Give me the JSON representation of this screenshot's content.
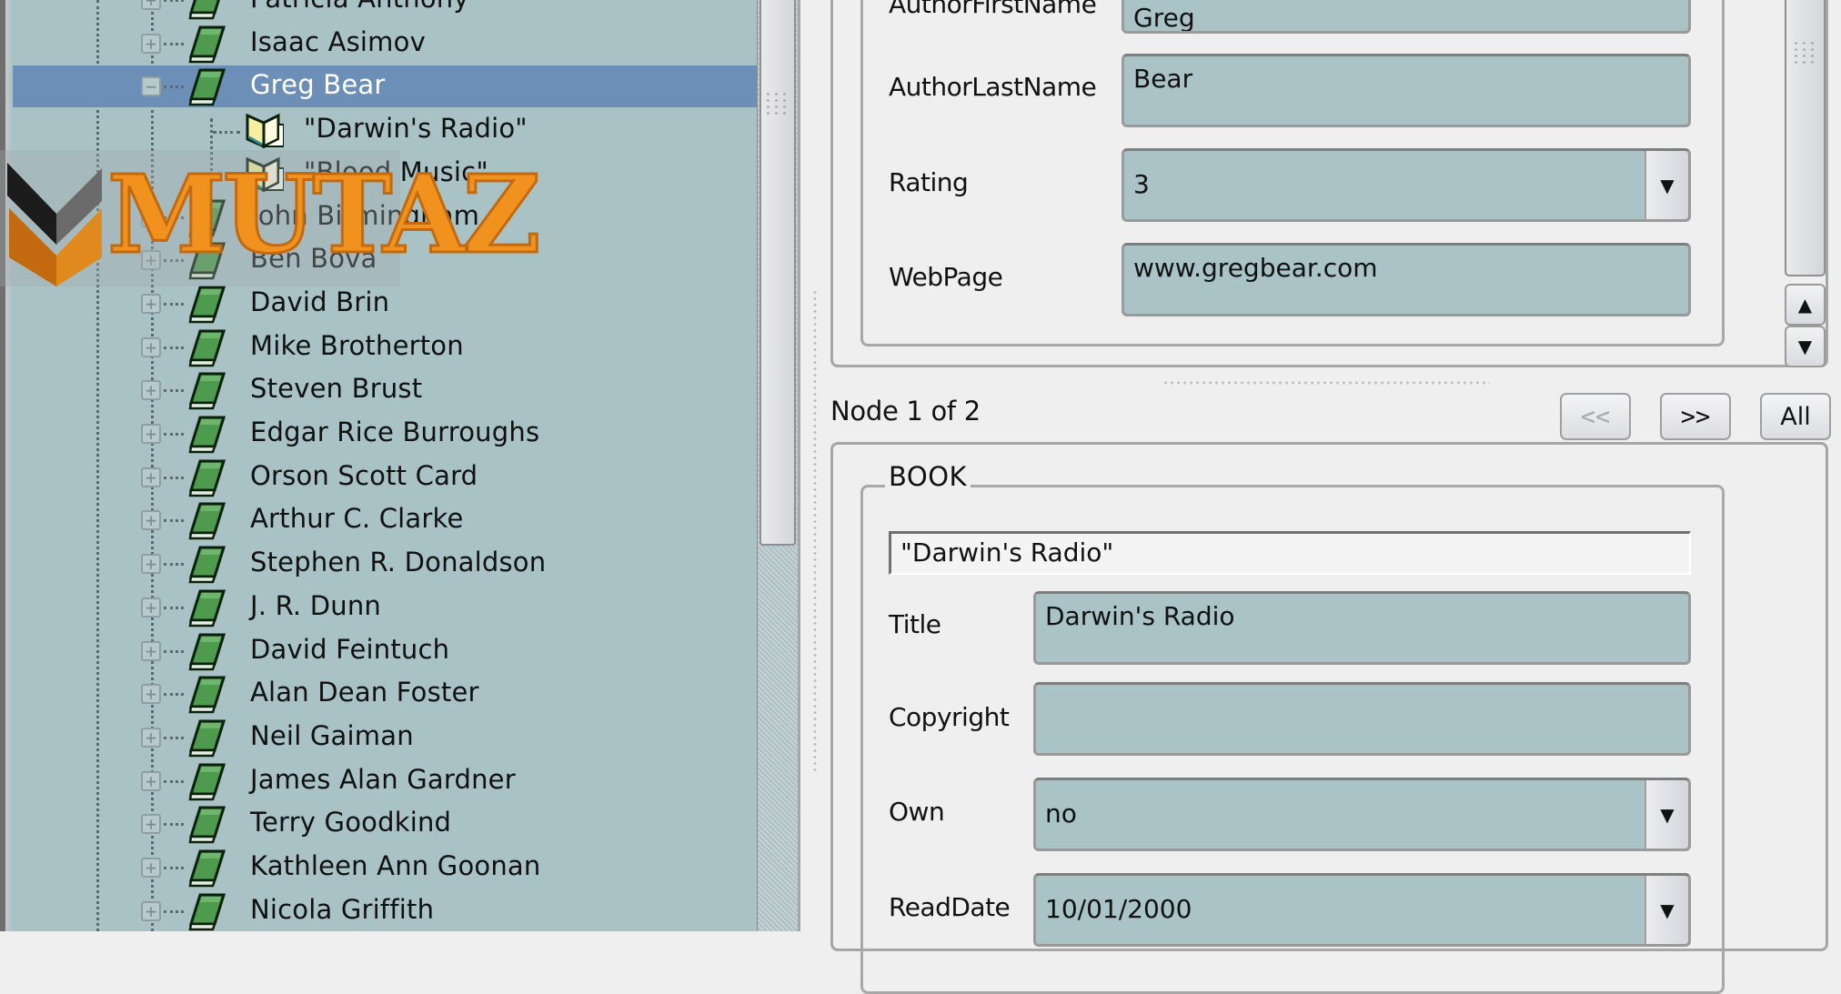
{
  "tree": {
    "items": [
      {
        "label": "Patricia Anthony",
        "level": 0,
        "expander": "+",
        "icon": "closed-book-icon",
        "selected": false
      },
      {
        "label": "Isaac Asimov",
        "level": 0,
        "expander": "+",
        "icon": "closed-book-icon",
        "selected": false
      },
      {
        "label": "Greg Bear",
        "level": 0,
        "expander": "−",
        "icon": "closed-book-icon",
        "selected": true
      },
      {
        "label": "\"Darwin's Radio\"",
        "level": 1,
        "expander": "",
        "icon": "open-book-icon",
        "selected": false
      },
      {
        "label": "\"Blood Music\"",
        "level": 1,
        "expander": "",
        "icon": "open-book-icon",
        "selected": false
      },
      {
        "label": "John Birmingham",
        "level": 0,
        "expander": "+",
        "icon": "closed-book-icon",
        "selected": false
      },
      {
        "label": "Ben Bova",
        "level": 0,
        "expander": "+",
        "icon": "closed-book-icon",
        "selected": false
      },
      {
        "label": "David Brin",
        "level": 0,
        "expander": "+",
        "icon": "closed-book-icon",
        "selected": false
      },
      {
        "label": "Mike Brotherton",
        "level": 0,
        "expander": "+",
        "icon": "closed-book-icon",
        "selected": false
      },
      {
        "label": "Steven Brust",
        "level": 0,
        "expander": "+",
        "icon": "closed-book-icon",
        "selected": false
      },
      {
        "label": "Edgar Rice Burroughs",
        "level": 0,
        "expander": "+",
        "icon": "closed-book-icon",
        "selected": false
      },
      {
        "label": "Orson Scott Card",
        "level": 0,
        "expander": "+",
        "icon": "closed-book-icon",
        "selected": false
      },
      {
        "label": "Arthur C. Clarke",
        "level": 0,
        "expander": "+",
        "icon": "closed-book-icon",
        "selected": false
      },
      {
        "label": "Stephen R. Donaldson",
        "level": 0,
        "expander": "+",
        "icon": "closed-book-icon",
        "selected": false
      },
      {
        "label": "J. R. Dunn",
        "level": 0,
        "expander": "+",
        "icon": "closed-book-icon",
        "selected": false
      },
      {
        "label": "David Feintuch",
        "level": 0,
        "expander": "+",
        "icon": "closed-book-icon",
        "selected": false
      },
      {
        "label": "Alan Dean Foster",
        "level": 0,
        "expander": "+",
        "icon": "closed-book-icon",
        "selected": false
      },
      {
        "label": "Neil Gaiman",
        "level": 0,
        "expander": "+",
        "icon": "closed-book-icon",
        "selected": false
      },
      {
        "label": "James Alan Gardner",
        "level": 0,
        "expander": "+",
        "icon": "closed-book-icon",
        "selected": false
      },
      {
        "label": "Terry Goodkind",
        "level": 0,
        "expander": "+",
        "icon": "closed-book-icon",
        "selected": false
      },
      {
        "label": "Kathleen Ann Goonan",
        "level": 0,
        "expander": "+",
        "icon": "closed-book-icon",
        "selected": false
      },
      {
        "label": "Nicola Griffith",
        "level": 0,
        "expander": "+",
        "icon": "closed-book-icon",
        "selected": false
      }
    ]
  },
  "author_form": {
    "fields": [
      {
        "label": "AuthorFirstName",
        "value": "Greg",
        "type": "text"
      },
      {
        "label": "AuthorLastName",
        "value": "Bear",
        "type": "text"
      },
      {
        "label": "Rating",
        "value": "3",
        "type": "combo"
      },
      {
        "label": "WebPage",
        "value": "www.gregbear.com",
        "type": "text"
      }
    ]
  },
  "navigation": {
    "node_label": "Node 1 of 2",
    "prev_label": "<<",
    "next_label": ">>",
    "all_label": "All",
    "prev_enabled": false
  },
  "book_form": {
    "group_title": "BOOK",
    "heading": "\"Darwin's Radio\"",
    "fields": [
      {
        "label": "Title",
        "value": "Darwin's Radio",
        "type": "text"
      },
      {
        "label": "Copyright",
        "value": "",
        "type": "text"
      },
      {
        "label": "Own",
        "value": "no",
        "type": "combo"
      },
      {
        "label": "ReadDate",
        "value": "10/01/2000",
        "type": "combo"
      }
    ]
  },
  "icons": {
    "scroll_up": "▲",
    "scroll_down": "▼",
    "combo_arrow": "▼"
  },
  "watermark": {
    "text": "MUTAZ"
  },
  "colors": {
    "tree_background": "#a9c2c6",
    "selection": "#6b8fb6",
    "input_background": "#a9c3c7",
    "window_background": "#efefef",
    "watermark_orange": "#f0921d"
  }
}
